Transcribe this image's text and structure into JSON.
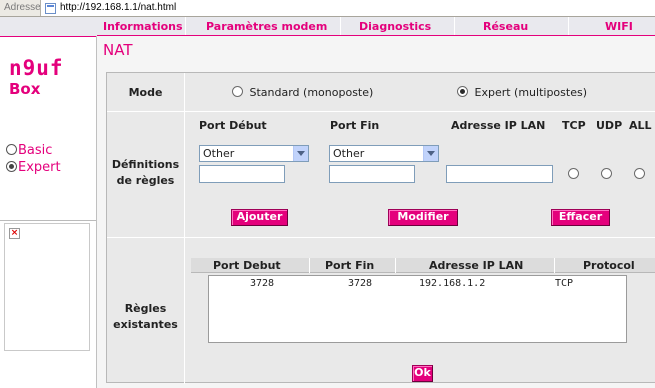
{
  "browser": {
    "address_label": "Adresse",
    "url": "http://192.168.1.1/nat.html"
  },
  "logo": {
    "line1": "n9uf",
    "line2": "Box"
  },
  "sidebar": {
    "modes": [
      {
        "label": "Basic",
        "selected": false
      },
      {
        "label": "Expert",
        "selected": true
      }
    ],
    "broken_image_icon": "broken-image-icon"
  },
  "menu": {
    "items": [
      "Informations",
      "Paramètres modem",
      "Diagnostics",
      "Réseau",
      "WIFI"
    ]
  },
  "page": {
    "title": "NAT"
  },
  "mode": {
    "label": "Mode",
    "options": [
      {
        "label": "Standard (monoposte)",
        "selected": false
      },
      {
        "label": "Expert (multipostes)",
        "selected": true
      }
    ]
  },
  "rules": {
    "label_line1": "Définitions",
    "label_line2": "de règles",
    "headers": {
      "port_start": "Port Début",
      "port_end": "Port Fin",
      "ip": "Adresse IP LAN",
      "tcp": "TCP",
      "udp": "UDP",
      "all": "ALL"
    },
    "port_start_select": "Other",
    "port_end_select": "Other",
    "port_start_value": "",
    "port_end_value": "",
    "ip_value": "",
    "protocol_selected": null,
    "buttons": {
      "add": "Ajouter",
      "modify": "Modifier",
      "delete": "Effacer"
    }
  },
  "existing": {
    "label_line1": "Règles",
    "label_line2": "existantes",
    "columns": [
      "Port Debut",
      "Port Fin",
      "Adresse IP LAN",
      "Protocol"
    ],
    "rows": [
      {
        "port_start": "3728",
        "port_end": "3728",
        "ip": "192.168.1.2",
        "protocol": "TCP"
      }
    ]
  },
  "ok_button": "Ok",
  "colors": {
    "accent": "#e4007c",
    "panel": "#e9e9e9",
    "menu_bg": "#e9e9ee"
  }
}
